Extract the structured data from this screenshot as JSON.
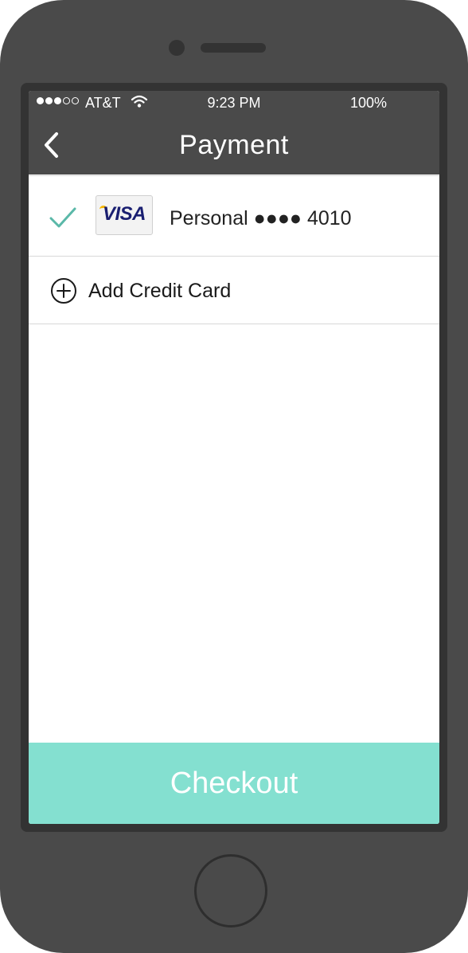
{
  "status_bar": {
    "signal_dots_full": 3,
    "signal_dots_total": 5,
    "carrier": "AT&T",
    "time": "9:23 PM",
    "battery": "100%"
  },
  "header": {
    "title": "Payment",
    "back_icon": "chevron-left-icon"
  },
  "payment_methods": [
    {
      "selected": true,
      "brand": "VISA",
      "label": "Personal ●●●● 4010"
    }
  ],
  "add_card": {
    "label": "Add Credit Card",
    "icon": "plus-circle-icon"
  },
  "checkout": {
    "label": "Checkout"
  },
  "colors": {
    "header_bg": "#4a4a4a",
    "accent": "#5ab8a8",
    "checkout_bg": "#84e0d0"
  }
}
